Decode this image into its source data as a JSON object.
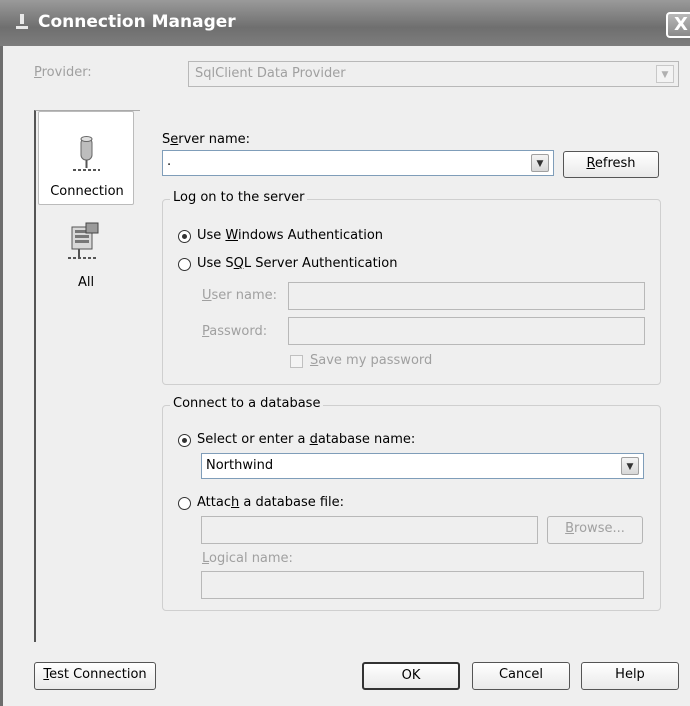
{
  "window": {
    "title": "Connection Manager",
    "close_glyph": "X"
  },
  "provider": {
    "label_pre": "",
    "label_u": "P",
    "label_post": "rovider:",
    "value": "SqlClient Data Provider"
  },
  "nav": {
    "items": [
      {
        "label": "Connection",
        "icon": "database-server-icon"
      },
      {
        "label": "All",
        "icon": "properties-grid-icon"
      }
    ]
  },
  "server": {
    "label_pre": "S",
    "label_u": "e",
    "label_post": "rver name:",
    "value": ".",
    "refresh_pre": "",
    "refresh_u": "R",
    "refresh_post": "efresh"
  },
  "logon": {
    "legend": "Log on to the server",
    "windows_auth": {
      "pre": "Use ",
      "u": "W",
      "post": "indows Authentication",
      "checked": true
    },
    "sql_auth": {
      "pre": "Use S",
      "u": "Q",
      "post": "L Server Authentication",
      "checked": false
    },
    "username_pre": "",
    "username_u": "U",
    "username_post": "ser name:",
    "password_pre": "",
    "password_u": "P",
    "password_post": "assword:",
    "save_pre": "",
    "save_u": "S",
    "save_post": "ave my password"
  },
  "database": {
    "legend": "Connect to a database",
    "select_option": {
      "pre": "Select or enter a ",
      "u": "d",
      "post": "atabase name:",
      "checked": true
    },
    "db_name": "Northwind",
    "attach_option": {
      "pre": "Attac",
      "u": "h",
      "post": " a database file:",
      "checked": false
    },
    "browse_pre": "",
    "browse_u": "B",
    "browse_post": "rowse...",
    "logical_pre": "",
    "logical_u": "L",
    "logical_post": "ogical name:"
  },
  "footer": {
    "test_pre": "",
    "test_u": "T",
    "test_post": "est Connection",
    "ok": "OK",
    "cancel": "Cancel",
    "help": "Help"
  }
}
